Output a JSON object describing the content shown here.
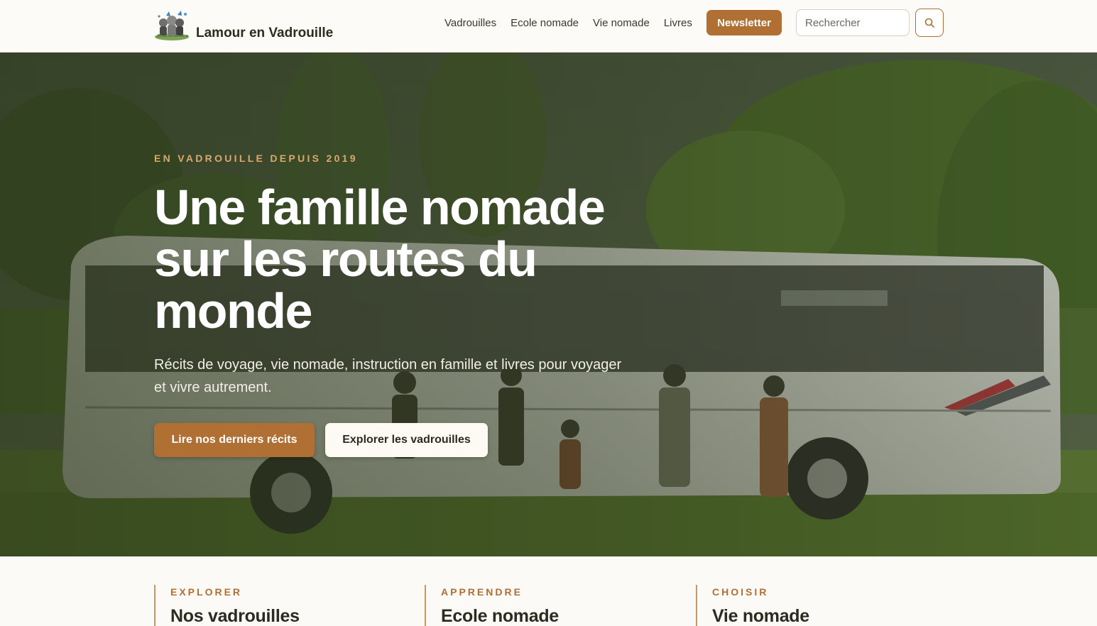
{
  "header": {
    "brand_name": "Lamour en Vadrouille",
    "logo_icon": "family-illustration-logo",
    "nav": [
      {
        "label": "Vadrouilles"
      },
      {
        "label": "Ecole nomade"
      },
      {
        "label": "Vie nomade"
      },
      {
        "label": "Livres"
      }
    ],
    "newsletter_label": "Newsletter",
    "search_placeholder": "Rechercher",
    "search_icon": "search-icon"
  },
  "hero": {
    "eyebrow": "EN VADROUILLE DEPUIS 2019",
    "title": "Une famille nomade sur les routes du monde",
    "subtitle": "Récits de voyage, vie nomade, instruction en famille et livres pour voyager et vivre autrement.",
    "primary_cta": "Lire nos derniers récits",
    "secondary_cta": "Explorer les vadrouilles"
  },
  "features": [
    {
      "eyebrow": "EXPLORER",
      "title": "Nos vadrouilles"
    },
    {
      "eyebrow": "APPRENDRE",
      "title": "Ecole nomade"
    },
    {
      "eyebrow": "CHOISIR",
      "title": "Vie nomade"
    }
  ],
  "colors": {
    "accent": "#b06f33",
    "eyebrow_hero": "#d9a86a",
    "header_bg": "#fdfbf7",
    "text_dark": "#2b2b20"
  }
}
